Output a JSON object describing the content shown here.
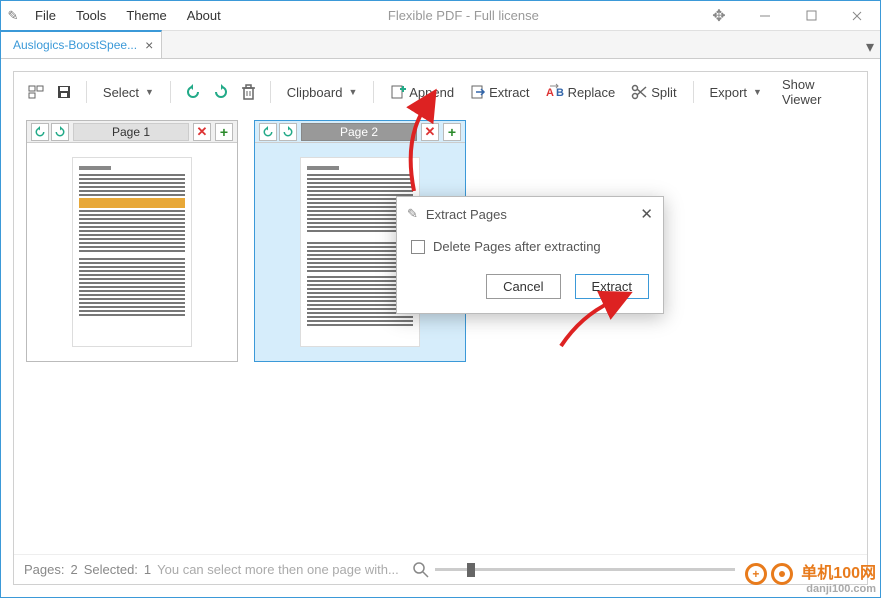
{
  "app": {
    "title": "Flexible PDF - Full license",
    "menu": [
      "File",
      "Tools",
      "Theme",
      "About"
    ]
  },
  "tab": {
    "label": "Auslogics-BoostSpee..."
  },
  "toolbar": {
    "select": "Select",
    "clipboard": "Clipboard",
    "append": "Append",
    "extract": "Extract",
    "replace": "Replace",
    "split": "Split",
    "export": "Export",
    "show_viewer": "Show Viewer"
  },
  "pages": [
    {
      "label": "Page 1",
      "selected": false
    },
    {
      "label": "Page 2",
      "selected": true
    }
  ],
  "status": {
    "pages_label": "Pages:",
    "pages_count": "2",
    "selected_label": "Selected:",
    "selected_count": "1",
    "hint": "You can select more then one page with..."
  },
  "dialog": {
    "title": "Extract Pages",
    "checkbox": "Delete Pages after extracting",
    "cancel": "Cancel",
    "extract": "Extract"
  },
  "watermark": {
    "main": "单机100网",
    "sub": "danji100.com"
  }
}
